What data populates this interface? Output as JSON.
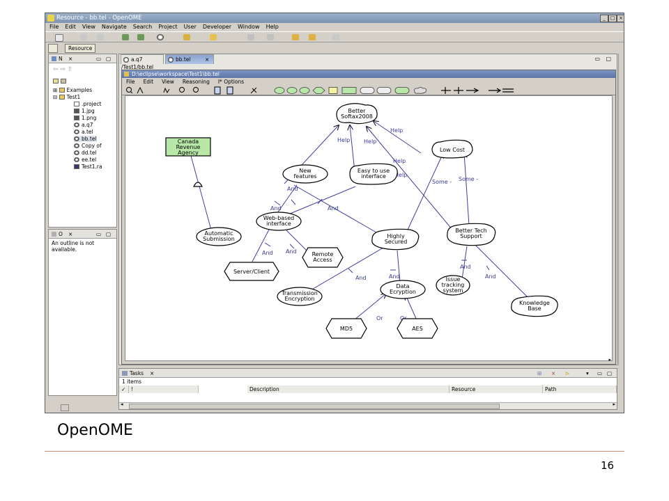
{
  "window": {
    "title": "Resource - bb.tel - OpenOME"
  },
  "menu": [
    "File",
    "Edit",
    "View",
    "Navigate",
    "Search",
    "Project",
    "User",
    "Developer",
    "Window",
    "Help"
  ],
  "perspective": {
    "label": "Resource"
  },
  "navigator": {
    "tab_label": "N",
    "items": [
      {
        "label": "Examples",
        "indent": 1
      },
      {
        "label": "Test1",
        "indent": 1
      },
      {
        "label": ".project",
        "indent": 2
      },
      {
        "label": "1.jpg",
        "indent": 2
      },
      {
        "label": "1.png",
        "indent": 2
      },
      {
        "label": "a.q7",
        "indent": 2
      },
      {
        "label": "a.tel",
        "indent": 2
      },
      {
        "label": "bb.tel",
        "indent": 2
      },
      {
        "label": "Copy of",
        "indent": 2
      },
      {
        "label": "dd.tel",
        "indent": 2
      },
      {
        "label": "ee.tel",
        "indent": 2
      },
      {
        "label": "Test1.ra",
        "indent": 2
      }
    ]
  },
  "outline": {
    "tab_label": "O",
    "message_line1": "An outline is not",
    "message_line2": "available."
  },
  "editor": {
    "tabs": [
      "a.q7",
      "bb.tel"
    ],
    "path": "/Test1/bb.tel",
    "inner_title": "D:\\eclipse\\workspace\\Test1\\bb.tel",
    "inner_menu": [
      "File",
      "Edit",
      "View",
      "Reasoning",
      "I* Options"
    ]
  },
  "diagram": {
    "nodes": {
      "better": "Better|Softax2008",
      "lowcost": "Low Cost",
      "cra": "Canada|Revenue|Agency",
      "newfeat": "New|features",
      "easy": "Easy to use|interface",
      "web": "Web-based|interface",
      "auto": "Automatic|Submission",
      "secured": "Highly|Secured",
      "tech": "Better Tech|Support",
      "server": "Server/Client",
      "remote": "Remote|Access",
      "trans": "Transmission|Encryption",
      "dataenc": "Data|Ecryption",
      "issue": "Issue|tracking|system",
      "kb": "Knowledge|Base",
      "md5": "MD5",
      "aes": "AES"
    },
    "labels": {
      "help": "Help",
      "and": "And",
      "some": "Some -",
      "or": "Or"
    }
  },
  "tasks": {
    "tab_label": "Tasks",
    "count": "1 items",
    "columns": [
      "!",
      "Description",
      "Resource",
      "Path"
    ]
  },
  "slide": {
    "caption": "OpenOME",
    "page_number": "16"
  }
}
